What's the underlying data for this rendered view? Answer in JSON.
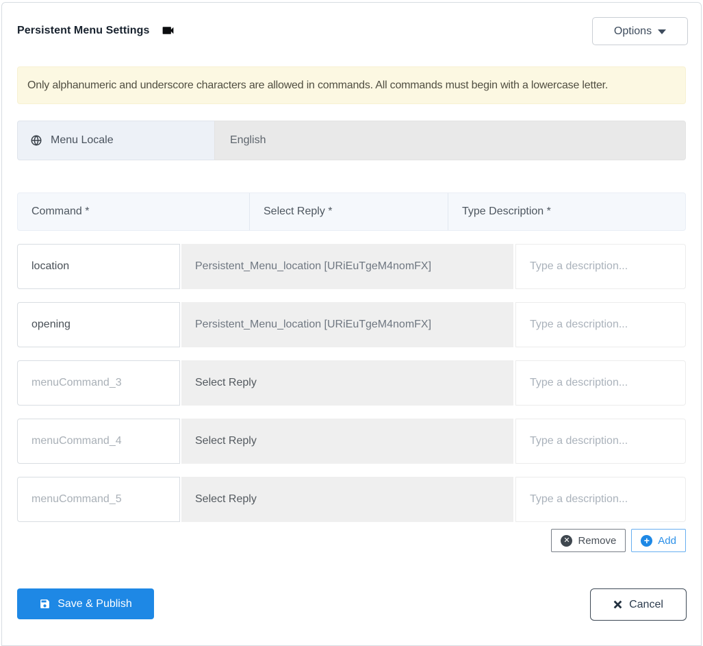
{
  "header": {
    "title": "Persistent Menu Settings",
    "options_button": "Options"
  },
  "alert": {
    "text": "Only alphanumeric and underscore characters are allowed in commands. All commands must begin with a lowercase letter."
  },
  "locale": {
    "label": "Menu Locale",
    "value": "English"
  },
  "table": {
    "columns": [
      "Command *",
      "Select Reply *",
      "Type Description *"
    ],
    "rows": [
      {
        "command_value": "location",
        "command_placeholder": "",
        "reply": "Persistent_Menu_location [URiEuTgeM4nomFX]",
        "reply_state": "selected",
        "description_value": "",
        "description_placeholder": "Type a description..."
      },
      {
        "command_value": "opening",
        "command_placeholder": "",
        "reply": "Persistent_Menu_location [URiEuTgeM4nomFX]",
        "reply_state": "selected",
        "description_value": "",
        "description_placeholder": "Type a description..."
      },
      {
        "command_value": "",
        "command_placeholder": "menuCommand_3",
        "reply": "Select Reply",
        "reply_state": "empty",
        "description_value": "",
        "description_placeholder": "Type a description..."
      },
      {
        "command_value": "",
        "command_placeholder": "menuCommand_4",
        "reply": "Select Reply",
        "reply_state": "empty",
        "description_value": "",
        "description_placeholder": "Type a description..."
      },
      {
        "command_value": "",
        "command_placeholder": "menuCommand_5",
        "reply": "Select Reply",
        "reply_state": "empty",
        "description_value": "",
        "description_placeholder": "Type a description..."
      }
    ]
  },
  "actions": {
    "remove_label": "Remove",
    "add_label": "Add"
  },
  "footer": {
    "save_label": "Save & Publish",
    "cancel_label": "Cancel"
  },
  "icons": {
    "title": "videocam-icon",
    "locale": "globe-icon",
    "remove": "circle-x-icon",
    "add": "circle-plus-icon",
    "save": "floppy-disk-icon",
    "cancel": "x-icon",
    "options": "chevron-down-icon"
  },
  "colors": {
    "primary_blue": "#1e88e5",
    "add_blue": "#2a8fe8",
    "alert_bg": "#fcf8e2",
    "reply_cell_bg": "#efefef",
    "header_bg": "#f5f8fc",
    "locale_label_bg": "#edf1f7",
    "locale_value_bg": "#e9e9e9"
  }
}
